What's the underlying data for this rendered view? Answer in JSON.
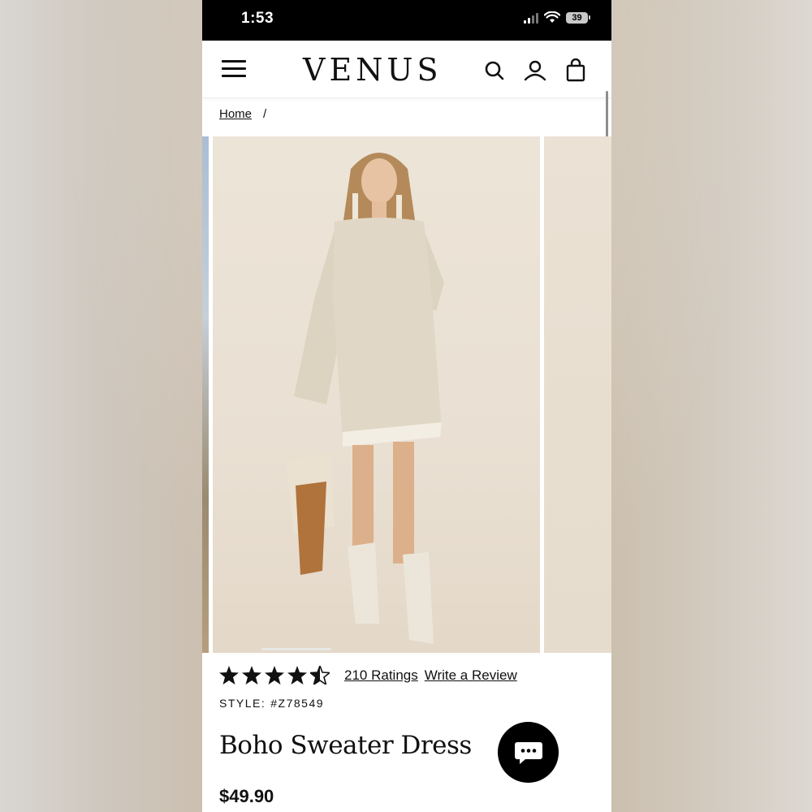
{
  "status_bar": {
    "time": "1:53",
    "battery": "39"
  },
  "header": {
    "logo": "VENUS",
    "icons": [
      "menu-icon",
      "search-icon",
      "account-icon",
      "shopping-bag-icon"
    ]
  },
  "breadcrumb": {
    "home": "Home",
    "separator": "/"
  },
  "product": {
    "rating_stars": 4.5,
    "ratings_link": "210 Ratings",
    "review_link": "Write a Review",
    "style_label": "STYLE:",
    "style_number": "#Z78549",
    "name": "Boho Sweater Dress",
    "price": "$49.90"
  },
  "colors": {
    "text": "#111111",
    "background": "#ffffff",
    "status_bar": "#000000",
    "chat_button": "#000000"
  }
}
